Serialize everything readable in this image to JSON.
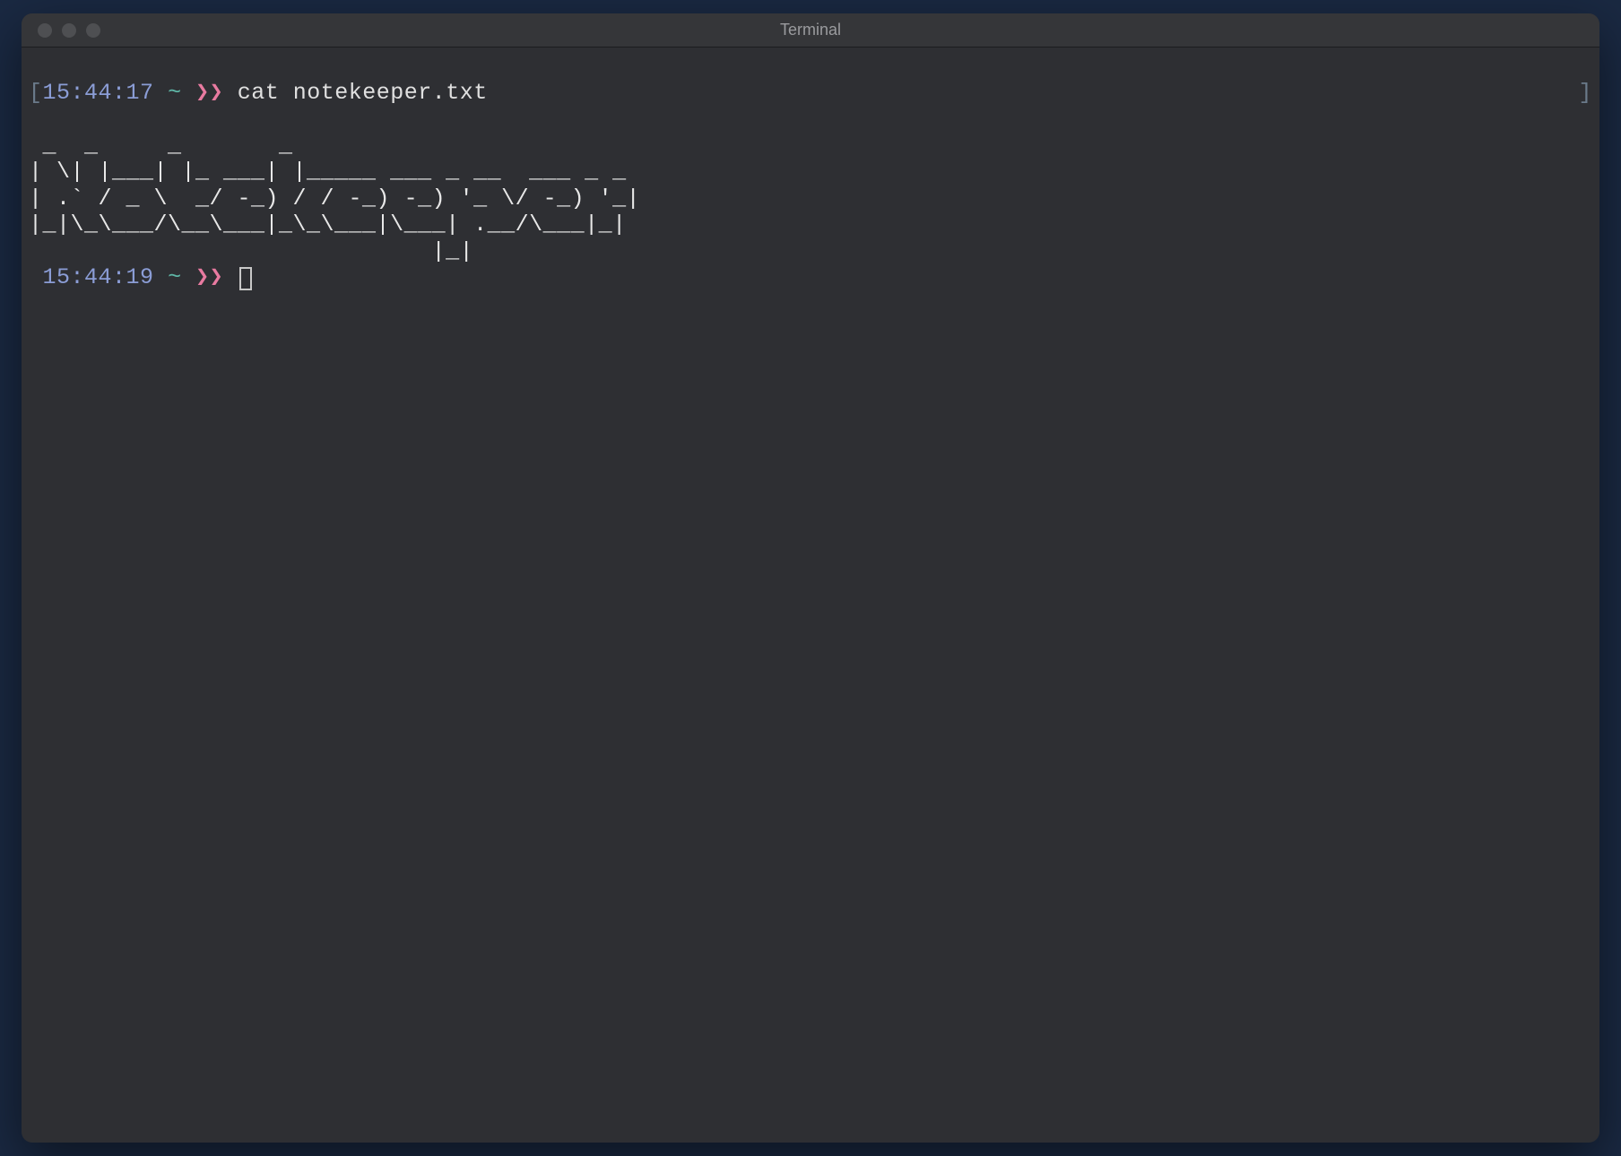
{
  "window": {
    "title": "Terminal"
  },
  "prompt1": {
    "open_bracket": "[",
    "time": "15:44:17",
    "tilde": "~",
    "chevrons": "❯❯",
    "command": "cat notekeeper.txt",
    "close_bracket": "]"
  },
  "ascii_art": " _  _     _       _                         \n| \\| |___| |_ ___| |_____ ___ _ __  ___ _ _ \n| .` / _ \\  _/ -_) / / -_) -_) '_ \\/ -_) '_|\n|_|\\_\\___/\\__\\___|_\\_\\___|\\___| .__/\\___|_|  \n                             |_|            ",
  "prompt2": {
    "time": "15:44:19",
    "tilde": "~",
    "chevrons": "❯❯"
  }
}
